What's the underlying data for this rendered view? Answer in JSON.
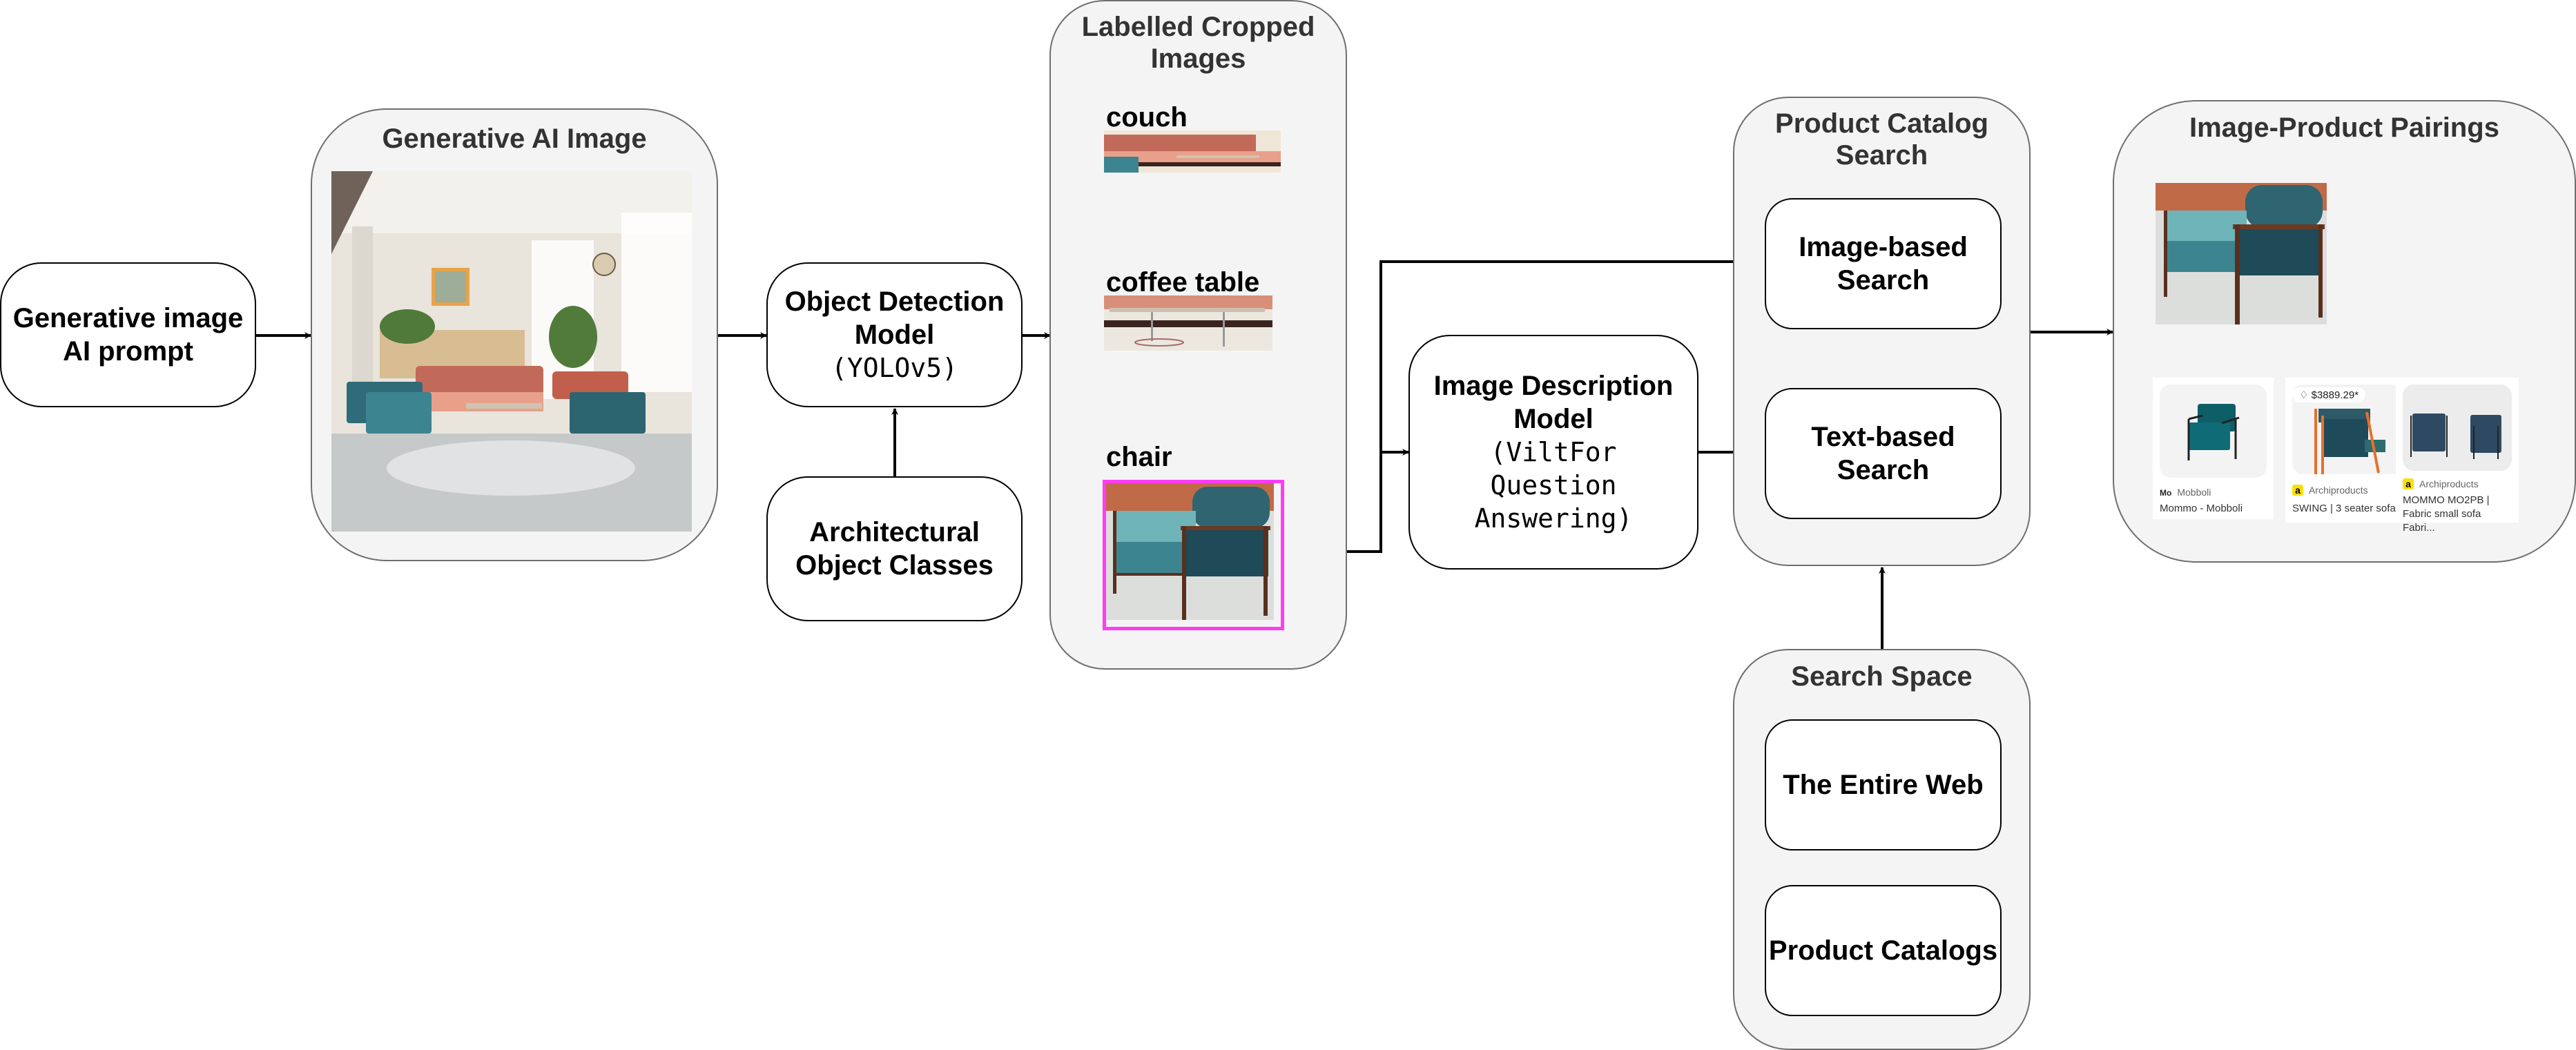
{
  "nodes": {
    "prompt": {
      "line1": "Generative image",
      "line2": "AI prompt"
    },
    "object_detection": {
      "line1": "Object Detection",
      "line2": "Model",
      "model": "(YOLOv5)"
    },
    "arch_classes": {
      "line1": "Architectural",
      "line2": "Object Classes"
    },
    "image_description": {
      "line1": "Image Description",
      "line2": "Model",
      "model_l1": "(ViltFor",
      "model_l2": "Question",
      "model_l3": "Answering)"
    },
    "image_search": {
      "line1": "Image-based",
      "line2": "Search"
    },
    "text_search": {
      "line1": "Text-based",
      "line2": "Search"
    },
    "entire_web": {
      "label": "The Entire Web"
    },
    "product_catalogs": {
      "label": "Product Catalogs"
    }
  },
  "groups": {
    "gen_image": {
      "title": "Generative AI Image"
    },
    "cropped": {
      "title_l1": "Labelled Cropped",
      "title_l2": "Images"
    },
    "catalog_search": {
      "title_l1": "Product Catalog",
      "title_l2": "Search"
    },
    "search_space": {
      "title": "Search Space"
    },
    "pairings": {
      "title": "Image-Product Pairings"
    }
  },
  "crops": [
    {
      "label": "couch"
    },
    {
      "label": "coffee table"
    },
    {
      "label": "chair",
      "highlight_color": "#ff3cf5"
    }
  ],
  "products": [
    {
      "source_badge": "Mo",
      "source": "Mobboli",
      "title": "Mommo - Mobboli"
    },
    {
      "price": "$3889.29*",
      "source_badge": "a",
      "source": "Archiproducts",
      "title": "SWING | 3 seater sofa"
    },
    {
      "source_badge": "a",
      "source": "Archiproducts",
      "title_l1": "MOMMO MO2PB |",
      "title_l2": "Fabric small sofa Fabri..."
    }
  ],
  "colors": {
    "highlight": "#ff3cf5",
    "group_fill": "#f4f4f4",
    "archiproducts_badge": "#f8e10a"
  }
}
